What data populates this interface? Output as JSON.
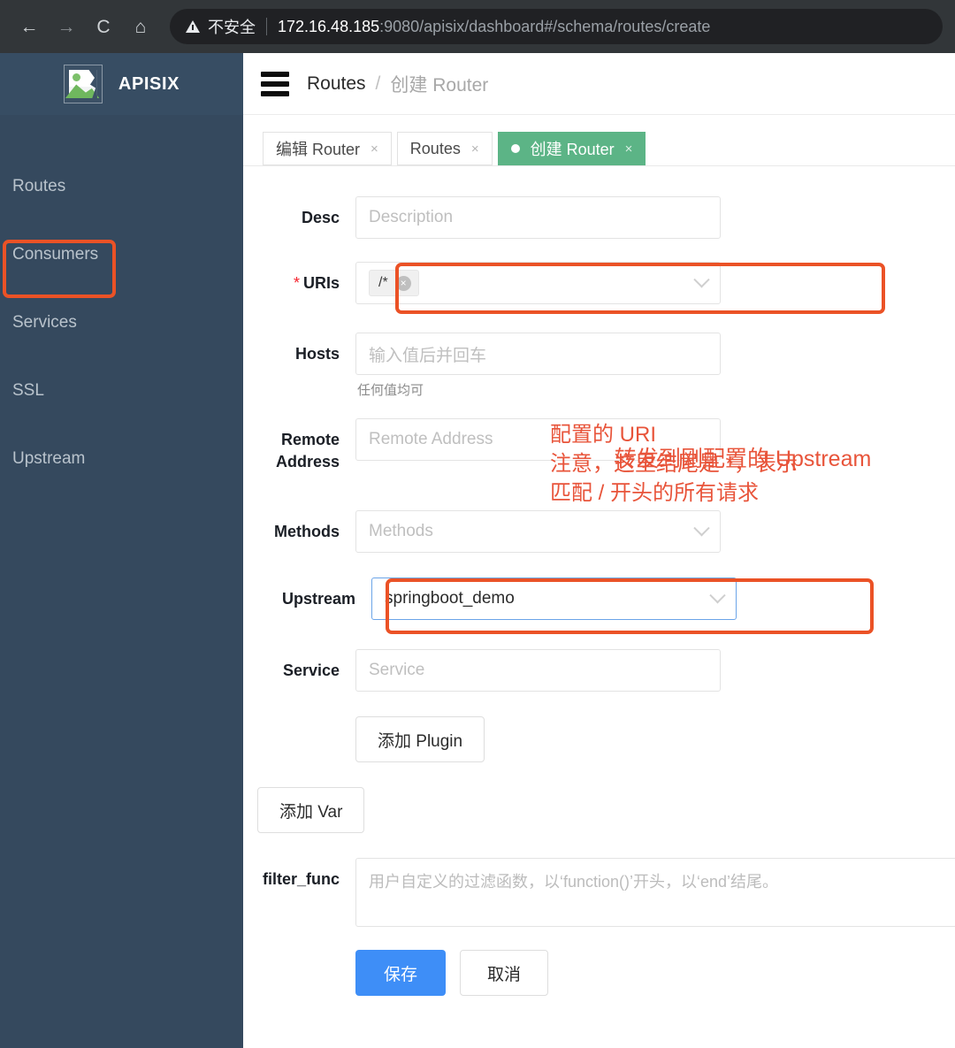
{
  "browser": {
    "back_icon": "←",
    "forward_icon": "→",
    "reload_icon": "C",
    "home_icon": "⌂",
    "security_label": "不安全",
    "url_host": "172.16.48.185",
    "url_rest": ":9080/apisix/dashboard#/schema/routes/create"
  },
  "sidebar": {
    "brand": "APISIX",
    "logo_icon": "broken-image-icon",
    "items": [
      {
        "label": "Routes"
      },
      {
        "label": "Consumers"
      },
      {
        "label": "Services"
      },
      {
        "label": "SSL"
      },
      {
        "label": "Upstream"
      }
    ]
  },
  "topbar": {
    "menu_icon": "hamburger-icon",
    "breadcrumb_root": "Routes",
    "breadcrumb_sep": "/",
    "breadcrumb_current": "创建 Router"
  },
  "tabs": [
    {
      "label": "编辑 Router",
      "close": "×",
      "active": false
    },
    {
      "label": "Routes",
      "close": "×",
      "active": false
    },
    {
      "label": "创建 Router",
      "close": "×",
      "active": true
    }
  ],
  "form": {
    "desc": {
      "label": "Desc",
      "placeholder": "Description",
      "value": ""
    },
    "uris": {
      "label": "URIs",
      "required_mark": "*",
      "tag_value": "/*",
      "tag_close": "×",
      "chevron": "chevron-down-icon"
    },
    "hosts": {
      "label": "Hosts",
      "placeholder": "输入值后并回车",
      "helper": "任何值均可"
    },
    "remote_address": {
      "label_line1": "Remote",
      "label_line2": "Address",
      "placeholder": "Remote Address"
    },
    "methods": {
      "label": "Methods",
      "placeholder": "Methods"
    },
    "upstream": {
      "label": "Upstream",
      "value": "springboot_demo"
    },
    "service": {
      "label": "Service",
      "placeholder": "Service"
    },
    "add_plugin": "添加 Plugin",
    "add_var": "添加 Var",
    "filter_func": {
      "label": "filter_func",
      "placeholder": "用户自定义的过滤函数，以‘function()’开头，以‘end’结尾。"
    },
    "save": "保存",
    "cancel": "取消"
  },
  "annotations": {
    "uris_note": "配置的 URI\n注意，这里结尾是 *，表示\n匹配 / 开头的所有请求",
    "upstream_note": "转发到刚配置的 Upstream",
    "highlight_color": "#eb5226"
  }
}
